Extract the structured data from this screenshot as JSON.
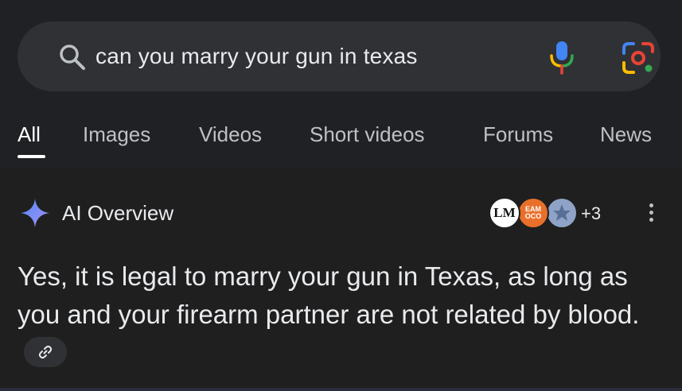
{
  "search": {
    "query": "can you marry your gun in texas",
    "icons": [
      "search-icon",
      "mic-icon",
      "lens-icon"
    ]
  },
  "tabs": [
    {
      "label": "All",
      "active": true
    },
    {
      "label": "Images",
      "active": false
    },
    {
      "label": "Videos",
      "active": false
    },
    {
      "label": "Short videos",
      "active": false
    },
    {
      "label": "Forums",
      "active": false
    },
    {
      "label": "News",
      "active": false
    }
  ],
  "ai_overview": {
    "title": "AI Overview",
    "sources": [
      {
        "name": "LM",
        "icon": "lm-logo"
      },
      {
        "name": "EAM OCO",
        "icon": "eam-logo"
      },
      {
        "name": "",
        "icon": "star-logo"
      }
    ],
    "more_sources": "+3",
    "answer": "Yes, it is legal to marry your gun in Texas, as long as you and your firearm partner are not related by blood."
  },
  "colors": {
    "background": "#1f1f1f",
    "search_bg": "#303134",
    "text": "#e8eaed",
    "tab_inactive": "#bdc1c6",
    "google_blue": "#4285f4",
    "google_red": "#ea4335",
    "google_yellow": "#fbbc04",
    "google_green": "#34a853"
  }
}
